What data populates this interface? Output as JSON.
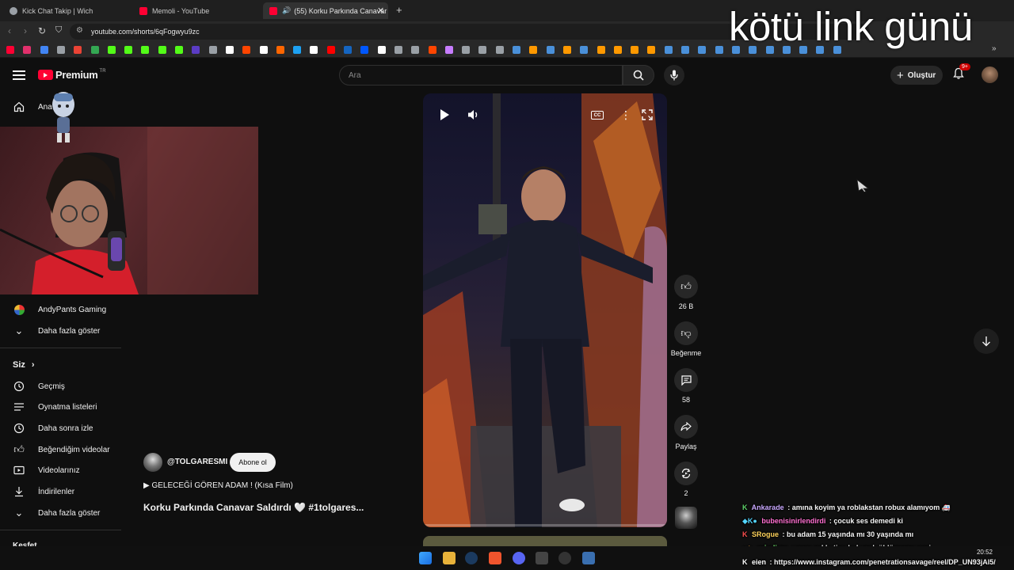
{
  "browser": {
    "tabs": [
      {
        "label": "Kick Chat Takip | Wich",
        "color": "#9aa0a6"
      },
      {
        "label": "Memoli - YouTube",
        "color": "#ff0033"
      },
      {
        "label": "(55) Korku Parkında Canavar S",
        "color": "#ff0033"
      }
    ],
    "new_tab_icon": "+",
    "url": "youtube.com/shorts/6qFogwyu9zc"
  },
  "overlay": {
    "stream_title": "kötü link günü"
  },
  "youtube": {
    "logo_text": "Premium",
    "logo_badge": "TR",
    "search_placeholder": "Ara",
    "create_label": "Oluştur",
    "notif_badge": "9+",
    "sidebar": {
      "home_label": "Ana",
      "sub_channel": "AndyPants Gaming",
      "show_more_1": "Daha fazla göster",
      "you_header": "Siz",
      "history": "Geçmiş",
      "playlists": "Oynatma listeleri",
      "watch_later": "Daha sonra izle",
      "liked": "Beğendiğim videolar",
      "your_videos": "Videolarınız",
      "downloads": "İndirilenler",
      "show_more_2": "Daha fazla göster",
      "explore_cut": "Keşfet"
    },
    "short": {
      "channel": "@TOLGARESMI",
      "subscribe": "Abone ol",
      "linked_video": "▶ GELECEĞİ GÖREN ADAM ! (Kısa Film)",
      "title": "Korku Parkında Canavar Saldırdı 🤍 #1tolgares..."
    },
    "actions": {
      "likes": "26 B",
      "dislike": "Beğenme",
      "comments": "58",
      "share": "Paylaş",
      "remix": "2"
    }
  },
  "chat": [
    {
      "nick": "Ankarade",
      "text": "amına koyim ya roblakstan robux alamıyom 🚑",
      "color": "#c9a8ff"
    },
    {
      "nick": "bubenisinirlendirdi",
      "text": "çocuk ses demedi ki",
      "color": "#ff6fd0"
    },
    {
      "nick": "SRogue",
      "text": "bu adam 15 yaşında mı 30 yaşında mı",
      "color": "#ffd35c"
    },
    {
      "nick": "oziodium",
      "text": "saça şekle tipe bak amk öldürecem seni",
      "color": "#7dff7a"
    },
    {
      "nick": "eien",
      "text": "https://www.instagram.com/penetrationsavage/reel/DP_UN93jAl5/",
      "color": "#ffffff"
    }
  ],
  "taskbar": {
    "time": "20:52",
    "date": "..."
  }
}
